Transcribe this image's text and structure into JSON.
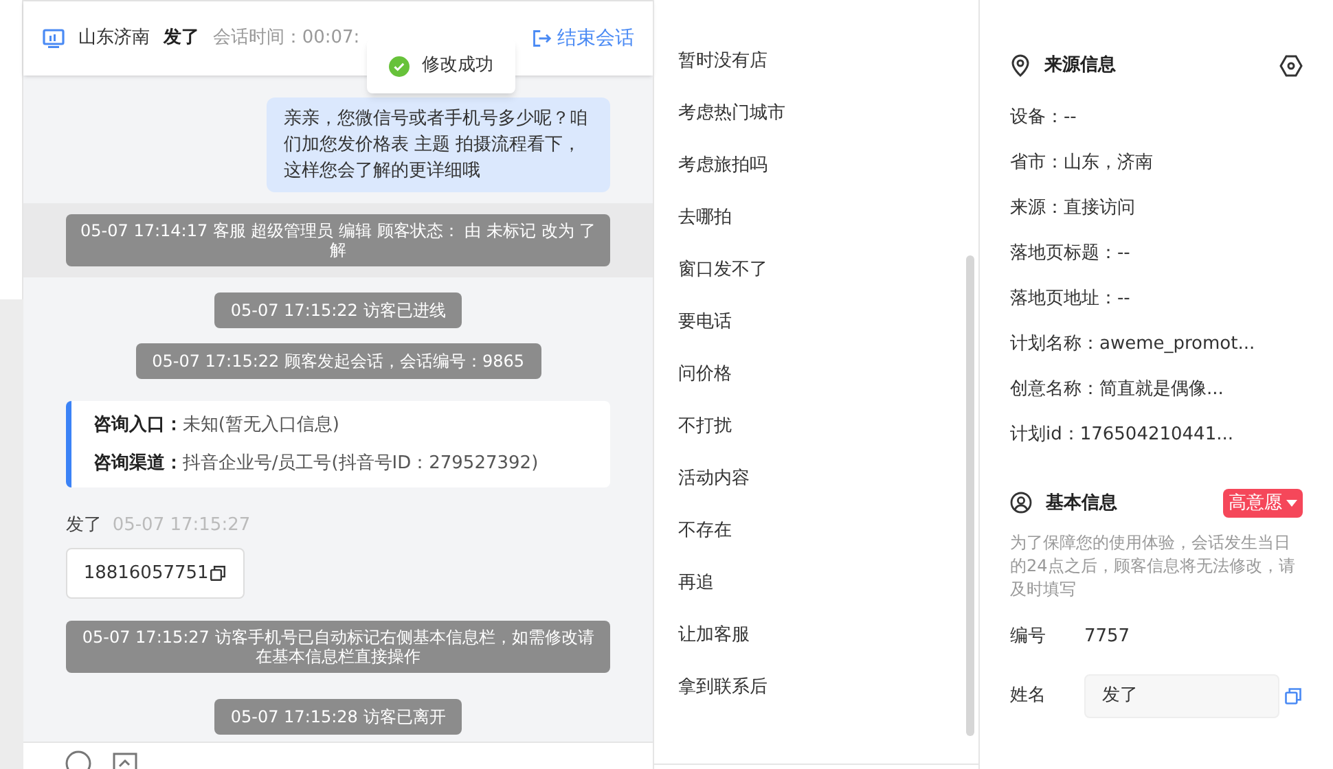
{
  "header": {
    "location": "山东济南",
    "visitor": "发了",
    "session_time_label": "会话时间：00:07:",
    "end_button": "结束会话"
  },
  "toast": {
    "text": "修改成功"
  },
  "messages": [
    {
      "kind": "agent",
      "text": "亲亲，您微信号或者手机号多少呢？咱们加您发价格表 主题 拍摄流程看下，这样您会了解的更详细哦"
    },
    {
      "kind": "system_wide",
      "text": "05-07 17:14:17 客服 超级管理员 编辑 顾客状态： 由 未标记 改为 了解",
      "highlighted": true
    },
    {
      "kind": "system",
      "text": "05-07 17:15:22 访客已进线"
    },
    {
      "kind": "system",
      "text": "05-07 17:15:22 顾客发起会话，会话编号：9865"
    },
    {
      "kind": "info",
      "rows": [
        {
          "label": "咨询入口：",
          "value": "未知(暂无入口信息)"
        },
        {
          "label": "咨询渠道：",
          "value": "抖音企业号/员工号(抖音号ID：279527392)"
        }
      ]
    },
    {
      "kind": "visitor",
      "name": "发了",
      "time": "05-07 17:15:27",
      "text": "18816057751"
    },
    {
      "kind": "system_wide",
      "text": "05-07 17:15:27 访客手机号已自动标记右侧基本信息栏，如需修改请在基本信息栏直接操作",
      "highlighted": false
    },
    {
      "kind": "system",
      "text": "05-07 17:15:28 访客已离开"
    }
  ],
  "quick_replies": [
    "暂时没有店",
    "考虑热门城市",
    "考虑旅拍吗",
    "去哪拍",
    "窗口发不了",
    "要电话",
    "问价格",
    "不打扰",
    "活动内容",
    "不存在",
    "再追",
    "让加客服",
    "拿到联系后"
  ],
  "source_info": {
    "title": "来源信息",
    "fields": [
      "设备：--",
      "省市：山东，济南",
      "来源：直接访问",
      "落地页标题：--",
      "落地页地址：--",
      "计划名称：aweme_promot...",
      "创意名称：简直就是偶像...",
      "计划id：176504210441..."
    ]
  },
  "basic_info": {
    "title": "基本信息",
    "intent_tag": "高意愿",
    "notice": "为了保障您的使用体验，会话发生当日的24点之后，顾客信息将无法修改，请及时填写",
    "id_label": "编号",
    "id_value": "7757",
    "name_label": "姓名",
    "name_value": "发了"
  }
}
